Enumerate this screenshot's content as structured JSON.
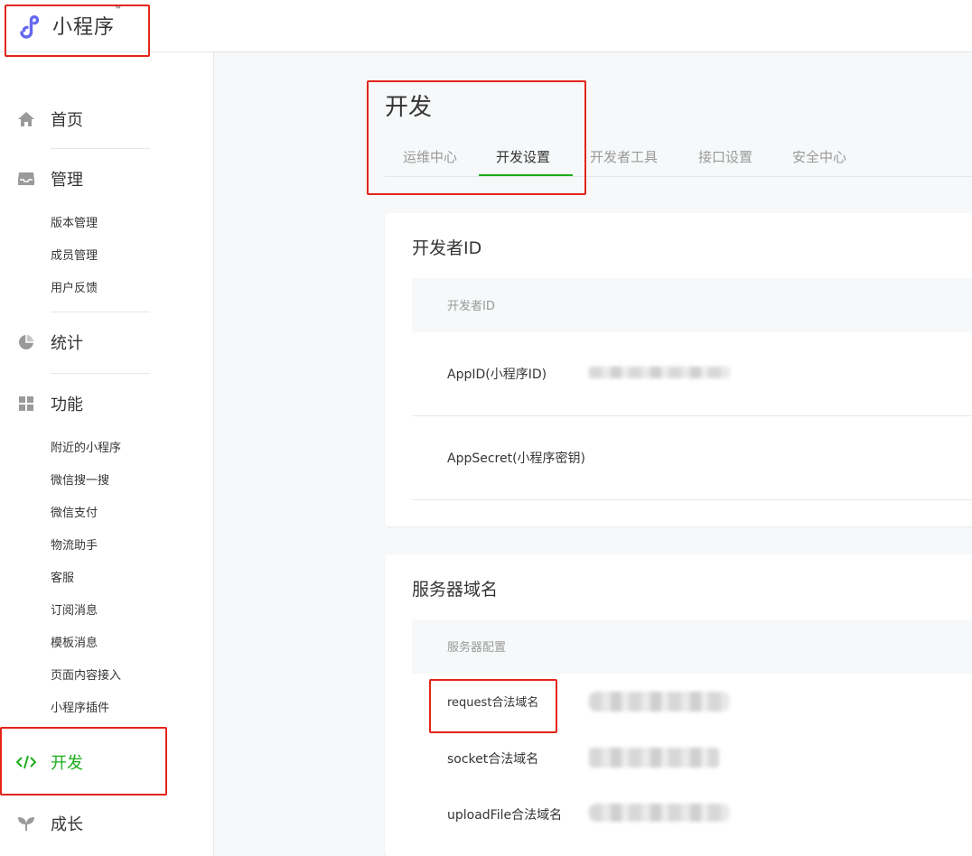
{
  "header": {
    "logo_text": "小程序",
    "logo_tm": "™"
  },
  "sidebar": {
    "home": "首页",
    "manage": "管理",
    "manage_items": [
      "版本管理",
      "成员管理",
      "用户反馈"
    ],
    "stats": "统计",
    "features": "功能",
    "feature_items": [
      "附近的小程序",
      "微信搜一搜",
      "微信支付",
      "物流助手",
      "客服",
      "订阅消息",
      "模板消息",
      "页面内容接入",
      "小程序插件"
    ],
    "develop": "开发",
    "growth": "成长"
  },
  "main": {
    "title": "开发",
    "tabs": [
      "运维中心",
      "开发设置",
      "开发者工具",
      "接口设置",
      "安全中心"
    ],
    "active_tab": "开发设置",
    "developer_id": {
      "title": "开发者ID",
      "header": "开发者ID",
      "rows": [
        "AppID(小程序ID)",
        "AppSecret(小程序密钥)"
      ]
    },
    "server_domain": {
      "title": "服务器域名",
      "header": "服务器配置",
      "rows": [
        "request合法域名",
        "socket合法域名",
        "uploadFile合法域名"
      ]
    }
  },
  "colors": {
    "accent": "#1aad19",
    "annotation": "#e4251a",
    "logo": "#6467f0"
  }
}
